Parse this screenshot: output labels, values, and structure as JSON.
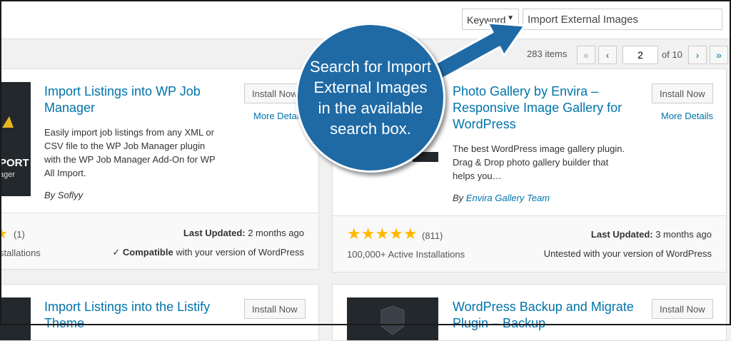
{
  "search": {
    "type_label": "Keyword",
    "value": "Import External Images"
  },
  "pagination": {
    "total_items": "283 items",
    "first": "«",
    "prev": "‹",
    "current_page": "2",
    "of_pages": "of 10",
    "next": "›",
    "last": "»"
  },
  "callout": {
    "text": "Search for Import External Images in the available search box."
  },
  "cards": [
    {
      "title": "Import Listings into WP Job Manager",
      "install_label": "Install Now",
      "more_details": "More Details",
      "description": "Easily import job listings from any XML or CSV file to the WP Job Manager plugin with the WP Job Manager Add-On for WP All Import.",
      "author": "By Soflyy",
      "thumb_text": "PORT",
      "thumb_sub": "ager",
      "rating_count": "(1)",
      "installs": "stallations",
      "last_updated_label": "Last Updated:",
      "last_updated": "2 months ago",
      "compat_check": "✓",
      "compat_bold": "Compatible",
      "compat_rest": "with your version of WordPress"
    },
    {
      "title": "Photo Gallery by Envira – Responsive Image Gallery for WordPress",
      "install_label": "Install Now",
      "more_details": "More Details",
      "description": "The best WordPress image gallery plugin. Drag & Drop photo gallery builder that helps you…",
      "author_prefix": "By",
      "author_name": "Envira Gallery Team",
      "stars": "★★★★★",
      "rating_count": "(811)",
      "installs": "100,000+ Active Installations",
      "last_updated_label": "Last Updated:",
      "last_updated": "3 months ago",
      "compat": "Untested with your version of WordPress"
    },
    {
      "title": "Import Listings into the Listify Theme",
      "install_label": "Install Now"
    },
    {
      "title": "WordPress Backup and Migrate Plugin – Backup",
      "install_label": "Install Now"
    }
  ],
  "colors": {
    "callout": "#1f6aa5",
    "link": "#0073aa",
    "star": "#ffb900"
  }
}
